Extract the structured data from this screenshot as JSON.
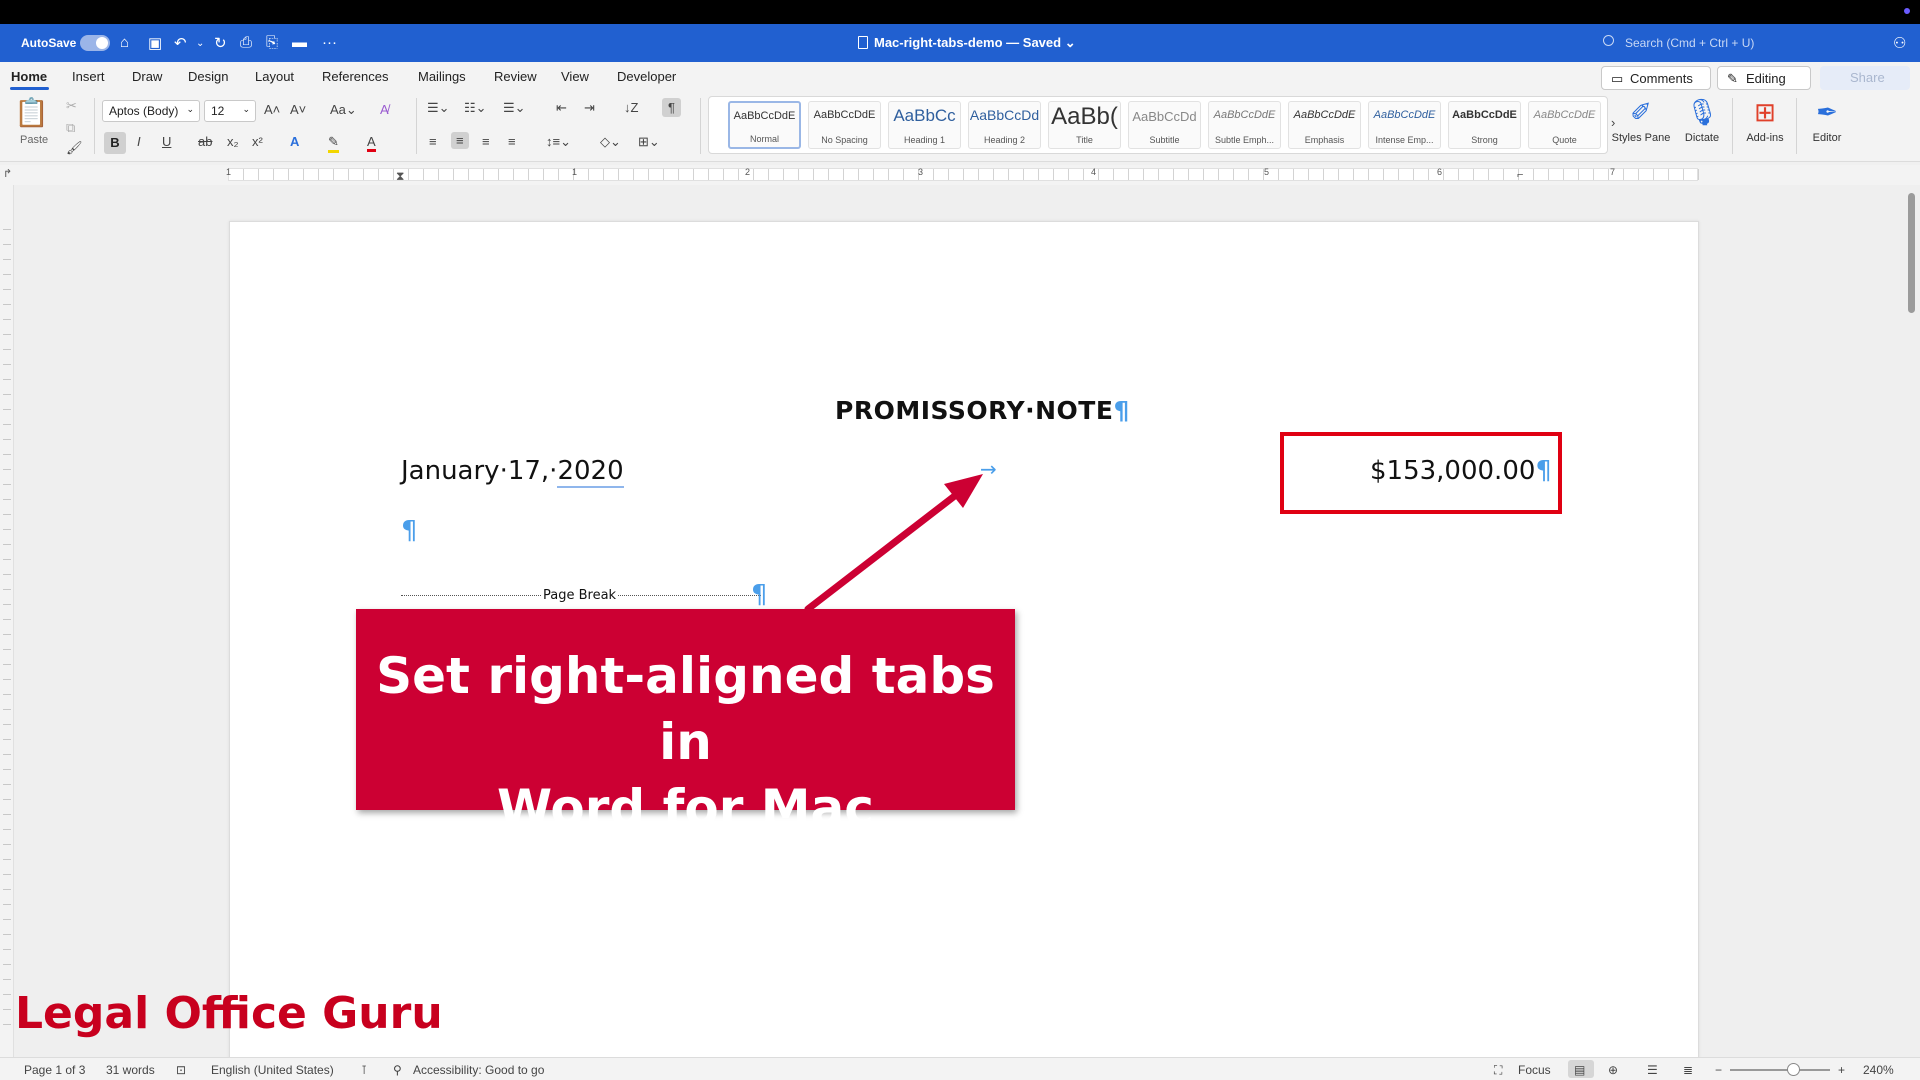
{
  "titlebar": {
    "autosave_label": "AutoSave",
    "document_title": "Mac-right-tabs-demo — Saved ⌄",
    "search_placeholder": "Search (Cmd + Ctrl + U)"
  },
  "ribbon_tabs": [
    "Home",
    "Insert",
    "Draw",
    "Design",
    "Layout",
    "References",
    "Mailings",
    "Review",
    "View",
    "Developer"
  ],
  "ribbon_right": {
    "comments_label": "Comments",
    "editing_label": "Editing",
    "share_label": "Share"
  },
  "ribbon": {
    "paste_label": "Paste",
    "font_name": "Aptos (Body)",
    "font_size": "12",
    "styles": [
      {
        "sample": "AaBbCcDdE",
        "name": "Normal"
      },
      {
        "sample": "AaBbCcDdE",
        "name": "No Spacing"
      },
      {
        "sample": "AaBbCc",
        "name": "Heading 1"
      },
      {
        "sample": "AaBbCcDd",
        "name": "Heading 2"
      },
      {
        "sample": "AaBb(",
        "name": "Title"
      },
      {
        "sample": "AaBbCcDd",
        "name": "Subtitle"
      },
      {
        "sample": "AaBbCcDdE",
        "name": "Subtle Emph..."
      },
      {
        "sample": "AaBbCcDdE",
        "name": "Emphasis"
      },
      {
        "sample": "AaBbCcDdE",
        "name": "Intense Emp..."
      },
      {
        "sample": "AaBbCcDdE",
        "name": "Strong"
      },
      {
        "sample": "AaBbCcDdE",
        "name": "Quote"
      }
    ],
    "styles_pane_label": "Styles Pane",
    "dictate_label": "Dictate",
    "addins_label": "Add-ins",
    "editor_label": "Editor"
  },
  "ruler": {
    "numbers": [
      "1",
      "1",
      "2",
      "3",
      "4",
      "5",
      "6",
      "7"
    ]
  },
  "document": {
    "heading": "PROMISSORY·NOTE",
    "date_text": "January·17,·",
    "date_year": "2020",
    "tab_arrow": "→",
    "amount": "$153,000.00",
    "pilcrow": "¶",
    "page_break_label": "Page Break"
  },
  "callout": {
    "line1": "Set right-aligned tabs in",
    "line2": "Word for Mac"
  },
  "watermark": "Legal Office Guru",
  "statusbar": {
    "page": "Page 1 of 3",
    "words": "31 words",
    "language": "English (United States)",
    "accessibility": "Accessibility: Good to go",
    "focus": "Focus",
    "zoom": "240%"
  },
  "colors": {
    "title_bar": "#2160d0",
    "callout_bg": "#cc0033",
    "highlight_border": "#e00012",
    "pilcrow": "#4a9eea",
    "watermark": "#c8001e"
  }
}
